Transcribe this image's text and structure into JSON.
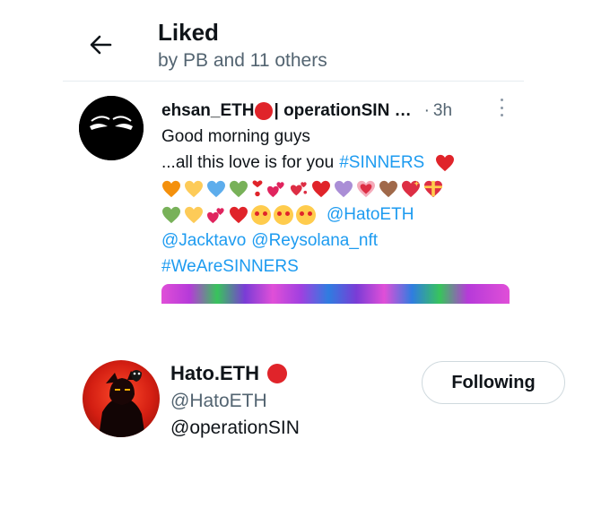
{
  "header": {
    "title": "Liked",
    "subtitle": "by PB and 11 others"
  },
  "tweet": {
    "author_name": "ehsan_ETH",
    "author_name_suffix": "| operationSIN …",
    "separator": "·",
    "time": "3h",
    "text_line1": "Good morning guys",
    "text_line2": "...all this love is for you",
    "hashtag1": "#SINNERS",
    "mention1": "@HatoETH",
    "mention2": "@Jacktavo",
    "mention3": "@Reysolana_nft",
    "hashtag2": "#WeAreSINNERS"
  },
  "follow_card": {
    "name": "Hato.ETH",
    "handle": "@HatoETH",
    "bio": "@operationSIN",
    "button_label": "Following"
  },
  "colors": {
    "link": "#1d9bf0",
    "secondary_text": "#536471",
    "red_badge": "#e0242a"
  },
  "icons": {
    "back": "arrow-left-icon",
    "more": "more-vertical-icon"
  }
}
